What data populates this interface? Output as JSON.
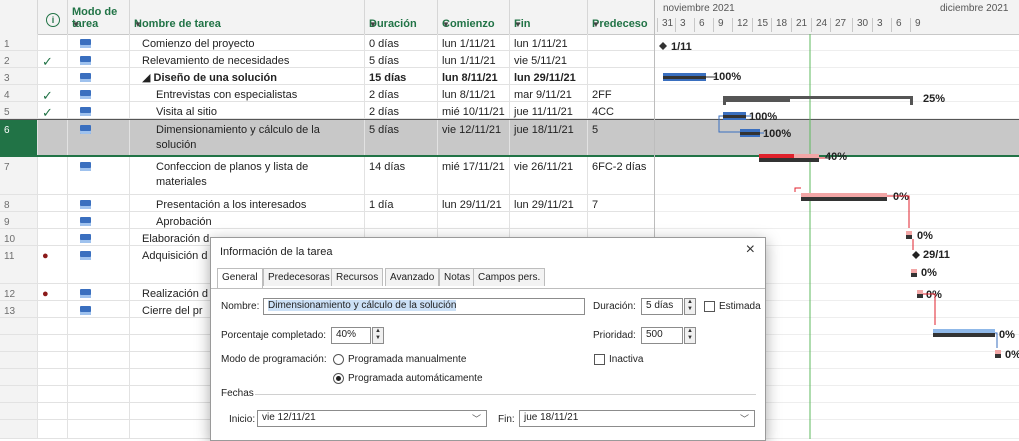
{
  "columns": {
    "info_icon": "i",
    "mode": "Modo de tarea",
    "name": "Nombre de tarea",
    "duration": "Duración",
    "start": "Comienzo",
    "finish": "Fin",
    "predecessors": "Predeceso"
  },
  "tasks": [
    {
      "id": "1",
      "check": "",
      "name": "Comienzo del proyecto",
      "duration": "0 días",
      "start": "lun 1/11/21",
      "finish": "lun 1/11/21",
      "pred": ""
    },
    {
      "id": "2",
      "check": "✓",
      "name": "Relevamiento de necesidades",
      "duration": "5 días",
      "start": "lun 1/11/21",
      "finish": "vie 5/11/21",
      "pred": ""
    },
    {
      "id": "3",
      "check": "",
      "name": "◢ Diseño de una solución",
      "duration": "15 días",
      "start": "lun 8/11/21",
      "finish": "lun 29/11/21",
      "pred": ""
    },
    {
      "id": "4",
      "check": "✓",
      "name": "Entrevistas con especialistas",
      "duration": "2 días",
      "start": "lun 8/11/21",
      "finish": "mar 9/11/21",
      "pred": "2FF"
    },
    {
      "id": "5",
      "check": "✓",
      "name": "Visita al sitio",
      "duration": "2 días",
      "start": "mié 10/11/21",
      "finish": "jue 11/11/21",
      "pred": "4CC"
    },
    {
      "id": "6",
      "check": "",
      "name": "Dimensionamiento y cálculo de la solución",
      "duration": "5 días",
      "start": "vie 12/11/21",
      "finish": "jue 18/11/21",
      "pred": "5"
    },
    {
      "id": "7",
      "check": "",
      "name": "Confeccion de planos y lista de materiales",
      "duration": "14 días",
      "start": "mié 17/11/21",
      "finish": "vie 26/11/21",
      "pred": "6FC-2 días"
    },
    {
      "id": "8",
      "check": "",
      "name": "Presentación a los interesados",
      "duration": "1 día",
      "start": "lun 29/11/21",
      "finish": "lun 29/11/21",
      "pred": "7"
    },
    {
      "id": "9",
      "check": "",
      "name": "Aprobación",
      "duration": "",
      "start": "",
      "finish": "",
      "pred": ""
    },
    {
      "id": "10",
      "check": "",
      "name": "Elaboración d",
      "duration": "",
      "start": "",
      "finish": "",
      "pred": ""
    },
    {
      "id": "11",
      "check": "",
      "name": "Adquisición d voluntarios (",
      "duration": "",
      "start": "",
      "finish": "",
      "pred": ""
    },
    {
      "id": "12",
      "check": "",
      "name": "Realización d",
      "duration": "",
      "start": "",
      "finish": "",
      "pred": ""
    },
    {
      "id": "13",
      "check": "",
      "name": "Cierre del pr",
      "duration": "",
      "start": "",
      "finish": "",
      "pred": ""
    }
  ],
  "gantt": {
    "months": [
      "noviembre 2021",
      "diciembre 2021"
    ],
    "days": [
      "31",
      "3",
      "6",
      "9",
      "12",
      "15",
      "18",
      "21",
      "24",
      "27",
      "30",
      "3",
      "6",
      "9"
    ],
    "labels": {
      "t1": "1/11",
      "t2": "100%",
      "t3": "25%",
      "t4": "100%",
      "t5": "100%",
      "t6": "40%",
      "t7": "0%",
      "t8": "0%",
      "t9": "29/11",
      "t10": "0%",
      "t11": "0%",
      "t12": "0%",
      "t13": "0%"
    },
    "progress": {
      "t2": 1.0,
      "t3": 0.25,
      "t4": 1.0,
      "t5": 1.0,
      "t6": 0.4,
      "t7": 0.0
    }
  },
  "colors": {
    "accent": "#217346",
    "task_bar": "#3a6fbf",
    "critical": "#e0222c",
    "critical_light": "#f2a6a6",
    "summary": "#555555"
  },
  "dialog": {
    "title": "Información de la tarea",
    "close": "×",
    "tabs": [
      "General",
      "Predecesoras",
      "Recursos",
      "Avanzado",
      "Notas",
      "Campos pers."
    ],
    "name_label": "Nombre:",
    "name_value": "Dimensionamiento y cálculo de la solución",
    "duration_label": "Duración:",
    "duration_value": "5 días",
    "estimated_label": "Estimada",
    "percent_label": "Porcentaje completado:",
    "percent_value": "40%",
    "priority_label": "Prioridad:",
    "priority_value": "500",
    "mode_label": "Modo de programación:",
    "mode_manual": "Programada manualmente",
    "mode_auto": "Programada automáticamente",
    "inactive_label": "Inactiva",
    "dates_label": "Fechas",
    "start_label": "Inicio:",
    "start_value": "vie 12/11/21",
    "finish_label": "Fin:",
    "finish_value": "jue 18/11/21"
  }
}
